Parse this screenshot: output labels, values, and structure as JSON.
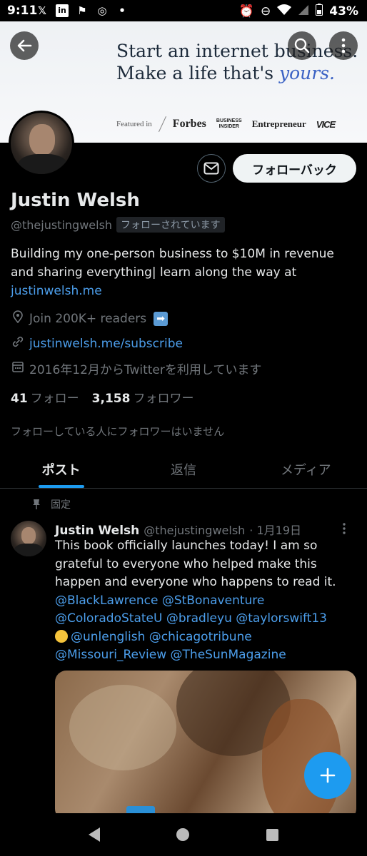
{
  "status_bar": {
    "time": "9:11",
    "battery": "43%",
    "left_icons": [
      "x-icon",
      "linkedin-icon",
      "flag-icon",
      "chrome-icon",
      "dot-icon"
    ],
    "right_icons": [
      "alarm-icon",
      "dnd-icon",
      "wifi-icon",
      "signal-icon",
      "battery-icon"
    ]
  },
  "banner": {
    "line1": "Start an internet business.",
    "line2_prefix": "Make a life that's ",
    "line2_em": "yours.",
    "featured_in": "Featured in",
    "logos": {
      "forbes": "Forbes",
      "business_insider_1": "BUSINESS",
      "business_insider_2": "INSIDER",
      "entrepreneur": "Entrepreneur",
      "vice": "VICE"
    }
  },
  "profile": {
    "name": "Justin Welsh",
    "handle": "@thejustingwelsh",
    "follows_you": "フォローされています",
    "follow_back_label": "フォローバック",
    "bio_text": "Building my one-person business to $10M in revenue and sharing everything| learn along the way at",
    "bio_link": "justinwelsh.me",
    "location": "Join 200K+ readers",
    "location_emoji": "➡",
    "website": "justinwelsh.me/subscribe",
    "joined": "2016年12月からTwitterを利用しています",
    "following_count": "41",
    "following_label": "フォロー",
    "followers_count": "3,158",
    "followers_label": "フォロワー",
    "no_mutual": "フォローしている人にフォロワーはいません"
  },
  "tabs": [
    {
      "label": "ポスト",
      "active": true
    },
    {
      "label": "返信",
      "active": false
    },
    {
      "label": "メディア",
      "active": false
    }
  ],
  "tweet": {
    "pinned_label": "固定",
    "name": "Justin Welsh",
    "handle": "@thejustingwelsh",
    "date": "· 1月19日",
    "text": "This book officially launches today! I am so grateful to everyone who helped make this happen and everyone who happens to read it.",
    "mentions_line1": "@BlackLawrence @StBonaventure",
    "mentions_line2": "@ColoradoStateU  @bradleyu @taylorswift13",
    "mentions_line3": "@unlenglish @chicagotribune",
    "mentions_line4": "@Missouri_Review @TheSunMagazine"
  },
  "colors": {
    "accent": "#1d9bf0",
    "link": "#4c9eeb",
    "muted": "#71767b",
    "text": "#e7e9ea",
    "background": "#000000"
  }
}
